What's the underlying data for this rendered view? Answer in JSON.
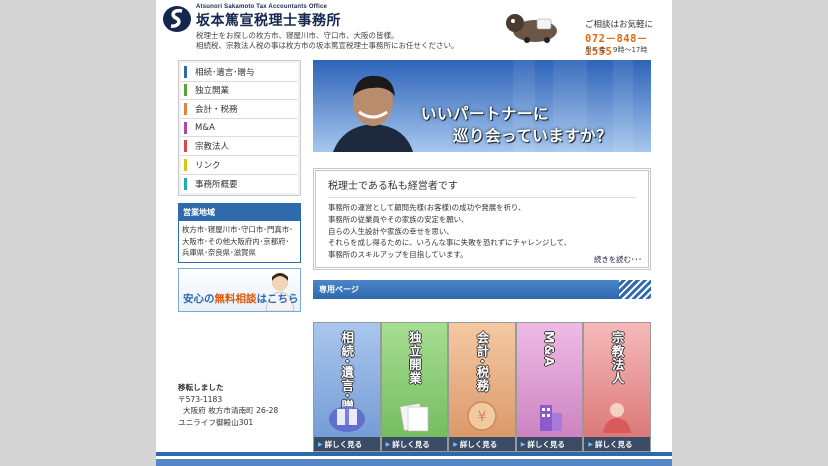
{
  "header": {
    "brand_en": "Atsunori Sakamoto Tax Accountants Office",
    "brand_jp": "坂本篤宣税理士事務所",
    "intro_line1": "税理士をお探しの枚方市、寝屋川市、守口市、大阪の皆様。",
    "intro_line2": "相続税、宗教法人税の事は枚方市の坂本篤宣税理士事務所にお任せください。",
    "contact_label": "ご相談はお気軽に",
    "phone": "072－848－1555",
    "hours": "月～金　9時～17時"
  },
  "sidebar": {
    "items": [
      {
        "label": "相続･遺言･贈与",
        "color": "#2f6aac"
      },
      {
        "label": "独立開業",
        "color": "#55a43a"
      },
      {
        "label": "会計・税務",
        "color": "#e0823a"
      },
      {
        "label": "M&A",
        "color": "#b4489c"
      },
      {
        "label": "宗教法人",
        "color": "#d84a4a"
      },
      {
        "label": "リンク",
        "color": "#d6c81a"
      },
      {
        "label": "事務所概要",
        "color": "#2aa6b4"
      }
    ],
    "region_title": "営業地域",
    "region_line1": "枚方市･寝屋川市･守口市･門真市･",
    "region_line2": "大阪市･その他大阪府内･京都府･",
    "region_line3": "兵庫県･奈良県･滋賀県",
    "consult_prefix": "安心の",
    "consult_highlight": "無料相談",
    "consult_suffix": "はこちら",
    "moved_title": "移転しました",
    "postal": "〒573-1183",
    "address1": "大阪府 枚方市清南町 26-28",
    "address2": "ユニライフ御殿山301"
  },
  "banner": {
    "line1": "いいパートナーに",
    "line2": "巡り会っていますか？"
  },
  "message": {
    "title": "税理士である私も経営者です",
    "lines": [
      "事務所の運営として顧問先様(お客様)の成功や発展を祈り、",
      "事務所の従業員やその家族の安定を願い、",
      "自らの人生設計や家族の幸せを思い、",
      "それらを成し得るために、いろんな事に失敗を恐れずにチャレンジして、",
      "事務所のスキルアップを目指しています。"
    ],
    "more": "続きを読む･･･"
  },
  "section": {
    "title": "専用ページ"
  },
  "cards": [
    {
      "label": "相続･遺言･贈与",
      "color": "#8fb4e3",
      "icon": "gift-icon"
    },
    {
      "label": "独立開業",
      "color": "#92cf7c",
      "icon": "documents-icon"
    },
    {
      "label": "会計･税務",
      "color": "#f0b98a",
      "icon": "coin-icon"
    },
    {
      "label": "M&A",
      "color": "#e3a3d8",
      "icon": "building-icon"
    },
    {
      "label": "宗教法人",
      "color": "#f2a2a2",
      "icon": "person-icon"
    }
  ],
  "card_button": "詳しく見る"
}
